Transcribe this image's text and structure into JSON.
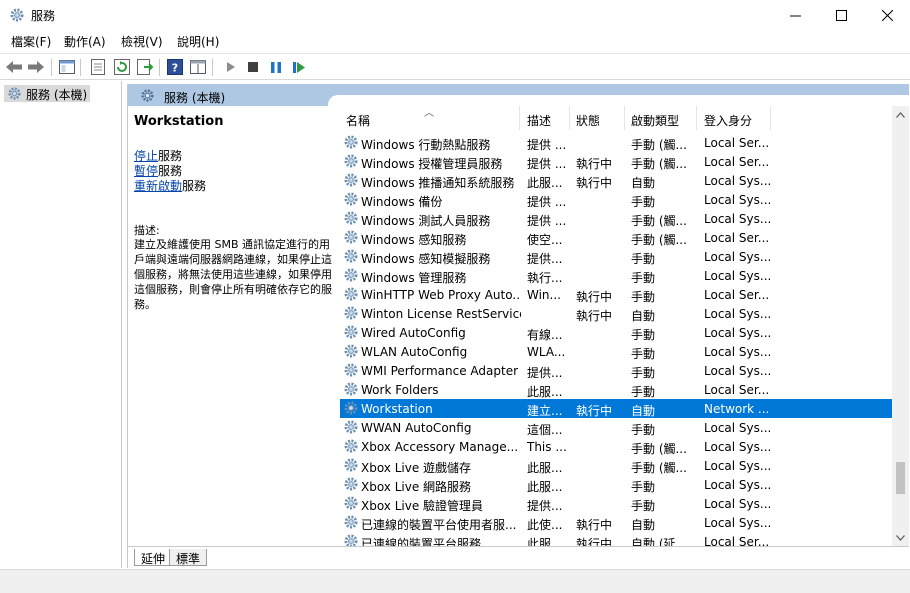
{
  "window": {
    "title": "服務"
  },
  "menu": [
    "檔案(F)",
    "動作(A)",
    "檢視(V)",
    "說明(H)"
  ],
  "toolbar": {
    "icons": [
      "back-icon",
      "forward-icon",
      "show-hide-tree-icon",
      "properties-icon",
      "refresh-icon",
      "export-list-icon",
      "help-icon",
      "view-icon",
      "start-service-icon",
      "stop-service-icon",
      "pause-service-icon",
      "resume-service-icon"
    ]
  },
  "tree": {
    "root": "服務 (本機)"
  },
  "panel": {
    "header": "服務 (本機)"
  },
  "extended": {
    "service_title": "Workstation",
    "links": [
      {
        "link": "停止",
        "rest": "服務"
      },
      {
        "link": "暫停",
        "rest": "服務"
      },
      {
        "link": "重新啟動",
        "rest": "服務"
      }
    ],
    "description_label": "描述:",
    "description": "建立及維護使用 SMB 通訊協定進行的用戶端與遠端伺服器網路連線，如果停止這個服務，將無法使用這些連線，如果停用這個服務，則會停止所有明確依存它的服務。"
  },
  "columns": {
    "name": "名稱",
    "description": "描述",
    "status": "狀態",
    "startup": "啟動類型",
    "logon": "登入身分"
  },
  "services": [
    {
      "name": "Windows 行動熱點服務",
      "description": "提供 ...",
      "status": "",
      "startup": "手動 (觸...",
      "logon": "Local Ser..."
    },
    {
      "name": "Windows 授權管理員服務",
      "description": "提供 ...",
      "status": "執行中",
      "startup": "手動 (觸...",
      "logon": "Local Ser..."
    },
    {
      "name": "Windows 推播通知系統服務",
      "description": "此服...",
      "status": "執行中",
      "startup": "自動",
      "logon": "Local Sys..."
    },
    {
      "name": "Windows 備份",
      "description": "提供 ...",
      "status": "",
      "startup": "手動",
      "logon": "Local Sys..."
    },
    {
      "name": "Windows 測試人員服務",
      "description": "提供 ...",
      "status": "",
      "startup": "手動 (觸...",
      "logon": "Local Sys..."
    },
    {
      "name": "Windows 感知服務",
      "description": "使空...",
      "status": "",
      "startup": "手動 (觸...",
      "logon": "Local Ser..."
    },
    {
      "name": "Windows 感知模擬服務",
      "description": "提供...",
      "status": "",
      "startup": "手動",
      "logon": "Local Sys..."
    },
    {
      "name": "Windows 管理服務",
      "description": "執行...",
      "status": "",
      "startup": "手動",
      "logon": "Local Sys..."
    },
    {
      "name": "WinHTTP Web Proxy Auto...",
      "description": "Win...",
      "status": "執行中",
      "startup": "手動",
      "logon": "Local Ser..."
    },
    {
      "name": "Winton License RestService",
      "description": "",
      "status": "執行中",
      "startup": "自動",
      "logon": "Local Sys..."
    },
    {
      "name": "Wired AutoConfig",
      "description": "有線...",
      "status": "",
      "startup": "手動",
      "logon": "Local Sys..."
    },
    {
      "name": "WLAN AutoConfig",
      "description": "WLA...",
      "status": "",
      "startup": "手動",
      "logon": "Local Sys..."
    },
    {
      "name": "WMI Performance Adapter",
      "description": "提供...",
      "status": "",
      "startup": "手動",
      "logon": "Local Sys..."
    },
    {
      "name": "Work Folders",
      "description": "此服...",
      "status": "",
      "startup": "手動",
      "logon": "Local Ser..."
    },
    {
      "name": "Workstation",
      "description": "建立...",
      "status": "執行中",
      "startup": "自動",
      "logon": "Network ...",
      "selected": true
    },
    {
      "name": "WWAN AutoConfig",
      "description": "這個...",
      "status": "",
      "startup": "手動",
      "logon": "Local Sys..."
    },
    {
      "name": "Xbox Accessory Manage...",
      "description": "This ...",
      "status": "",
      "startup": "手動 (觸...",
      "logon": "Local Sys..."
    },
    {
      "name": "Xbox Live 遊戲儲存",
      "description": "此服...",
      "status": "",
      "startup": "手動 (觸...",
      "logon": "Local Sys..."
    },
    {
      "name": "Xbox Live 網路服務",
      "description": "此服...",
      "status": "",
      "startup": "手動",
      "logon": "Local Sys..."
    },
    {
      "name": "Xbox Live 驗證管理員",
      "description": "提供...",
      "status": "",
      "startup": "手動",
      "logon": "Local Sys..."
    },
    {
      "name": "已連線的裝置平台使用者服...",
      "description": "此使...",
      "status": "執行中",
      "startup": "自動",
      "logon": "Local Sys..."
    },
    {
      "name": "已連線的裝置平台服務",
      "description": "此服...",
      "status": "執行中",
      "startup": "自動 (延...",
      "logon": "Local Ser..."
    }
  ],
  "tabs": [
    "延伸",
    "標準"
  ],
  "colors": {
    "selection": "#0078d7",
    "panel_header": "#aec7e3",
    "link": "#0645ad"
  }
}
